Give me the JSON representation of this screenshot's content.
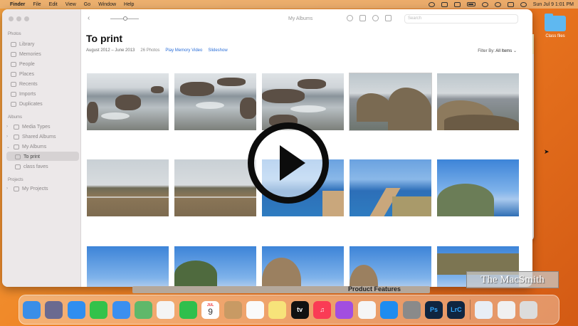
{
  "menubar": {
    "items": [
      "Finder",
      "File",
      "Edit",
      "View",
      "Go",
      "Window",
      "Help"
    ],
    "clock": "Sun Jul 9  1:01 PM"
  },
  "desktop": {
    "folder_label": "Class files"
  },
  "sidebar": {
    "sections": {
      "photos": "Photos",
      "albums": "Albums",
      "projects": "Projects"
    },
    "photos_items": [
      "Library",
      "Memories",
      "People",
      "Places",
      "Recents",
      "Imports",
      "Duplicates"
    ],
    "album_items": [
      "Media Types",
      "Shared Albums",
      "My Albums"
    ],
    "my_albums": [
      "To print",
      "class faves"
    ],
    "project_items": [
      "My Projects"
    ]
  },
  "toolbar": {
    "title": "My Albums",
    "search_placeholder": "Search"
  },
  "album": {
    "title": "To print",
    "date_range": "August 2012 – June 2013",
    "count": "26 Photos",
    "play_memory": "Play Memory Video",
    "slideshow": "Slideshow",
    "filter_label": "Filter By:",
    "filter_value": "All Items"
  },
  "overlay": {
    "watermark": "The MacSmith",
    "strip_label": "Product Features"
  },
  "dock": {
    "calendar_month": "JUL",
    "calendar_day": "9",
    "apps": [
      {
        "name": "finder",
        "color": "#3a8ee8",
        "glyph": ""
      },
      {
        "name": "launchpad",
        "color": "#6a6a90",
        "glyph": ""
      },
      {
        "name": "safari",
        "color": "#2f8ef0",
        "glyph": ""
      },
      {
        "name": "messages",
        "color": "#33c24a",
        "glyph": ""
      },
      {
        "name": "mail",
        "color": "#3b8ff0",
        "glyph": ""
      },
      {
        "name": "maps",
        "color": "#5fb86a",
        "glyph": ""
      },
      {
        "name": "photos",
        "color": "#f4f4f4",
        "glyph": ""
      },
      {
        "name": "facetime",
        "color": "#2fbf4c",
        "glyph": ""
      },
      {
        "name": "calendar",
        "color": "#ffffff",
        "glyph": ""
      },
      {
        "name": "contacts",
        "color": "#c89a64",
        "glyph": ""
      },
      {
        "name": "reminders",
        "color": "#fafafa",
        "glyph": ""
      },
      {
        "name": "notes",
        "color": "#f7e37a",
        "glyph": ""
      },
      {
        "name": "tv",
        "color": "#111111",
        "glyph": "tv"
      },
      {
        "name": "music",
        "color": "#fa3b55",
        "glyph": "♫"
      },
      {
        "name": "podcasts",
        "color": "#a24ee0",
        "glyph": ""
      },
      {
        "name": "news",
        "color": "#f5f5f5",
        "glyph": ""
      },
      {
        "name": "app-store",
        "color": "#1e8cf0",
        "glyph": ""
      },
      {
        "name": "system-settings",
        "color": "#8a8a8a",
        "glyph": ""
      },
      {
        "name": "photoshop",
        "color": "#0f2540",
        "glyph": "Ps"
      },
      {
        "name": "lightroom",
        "color": "#0f2540",
        "glyph": "LrC"
      },
      {
        "name": "preview",
        "color": "#e8eef5",
        "glyph": ""
      },
      {
        "name": "document",
        "color": "#f0f0f0",
        "glyph": ""
      },
      {
        "name": "trash",
        "color": "#dcdcdc",
        "glyph": ""
      }
    ]
  }
}
